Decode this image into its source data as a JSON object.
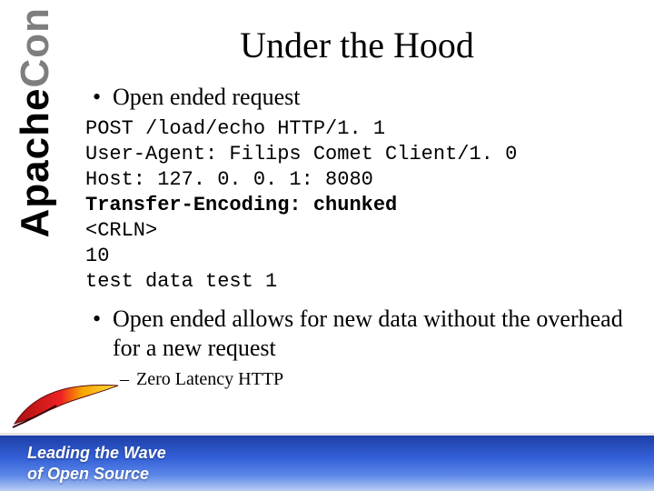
{
  "brand": {
    "part1": "Apache",
    "part2": "Con"
  },
  "title": "Under the Hood",
  "bullet1": "Open ended request",
  "code": {
    "l1": "POST /load/echo HTTP/1. 1",
    "l2": "User-Agent: Filips Comet Client/1. 0",
    "l3": "Host: 127. 0. 0. 1: 8080",
    "l4": "Transfer-Encoding: chunked",
    "l5": "<CRLN>",
    "l6": "10",
    "l7": "test data test 1"
  },
  "bullet2": "Open ended allows for new data without the overhead for a new request",
  "sub1": "Zero Latency HTTP",
  "footer": {
    "line1": "Leading the Wave",
    "line2": "of Open Source"
  }
}
